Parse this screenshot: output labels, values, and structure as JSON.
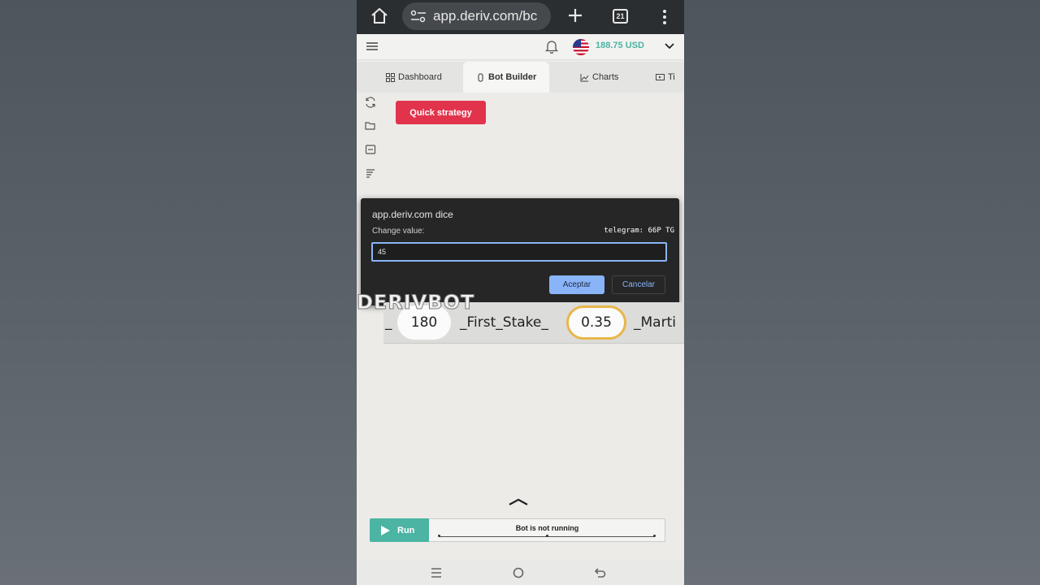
{
  "browser": {
    "url": "app.deriv.com/bc",
    "tab_count": "21"
  },
  "header": {
    "balance": "188.75 USD"
  },
  "tabs": [
    {
      "label": "Dashboard"
    },
    {
      "label": "Bot Builder"
    },
    {
      "label": "Charts"
    },
    {
      "label": "Ti"
    }
  ],
  "toolbar": {
    "quick_strategy": "Quick strategy"
  },
  "dialog": {
    "title": "app.deriv.com dice",
    "label": "Change value:",
    "overlay_text": "telegram: 66P TG",
    "value": "45",
    "ok": "Aceptar",
    "cancel": "Cancelar"
  },
  "watermark": "DERIVBOT",
  "block": {
    "prefix": "_",
    "value1": "180",
    "text1": "_First_Stake_",
    "value2": "0.35",
    "text2": "_Marti"
  },
  "runpanel": {
    "run": "Run",
    "status": "Bot is not running"
  },
  "colors": {
    "accent_green": "#4bb4a3",
    "quick_strategy_red": "#e1344c",
    "dialog_button_blue": "#8ab4f8",
    "highlight_ring": "#e9b64a"
  }
}
